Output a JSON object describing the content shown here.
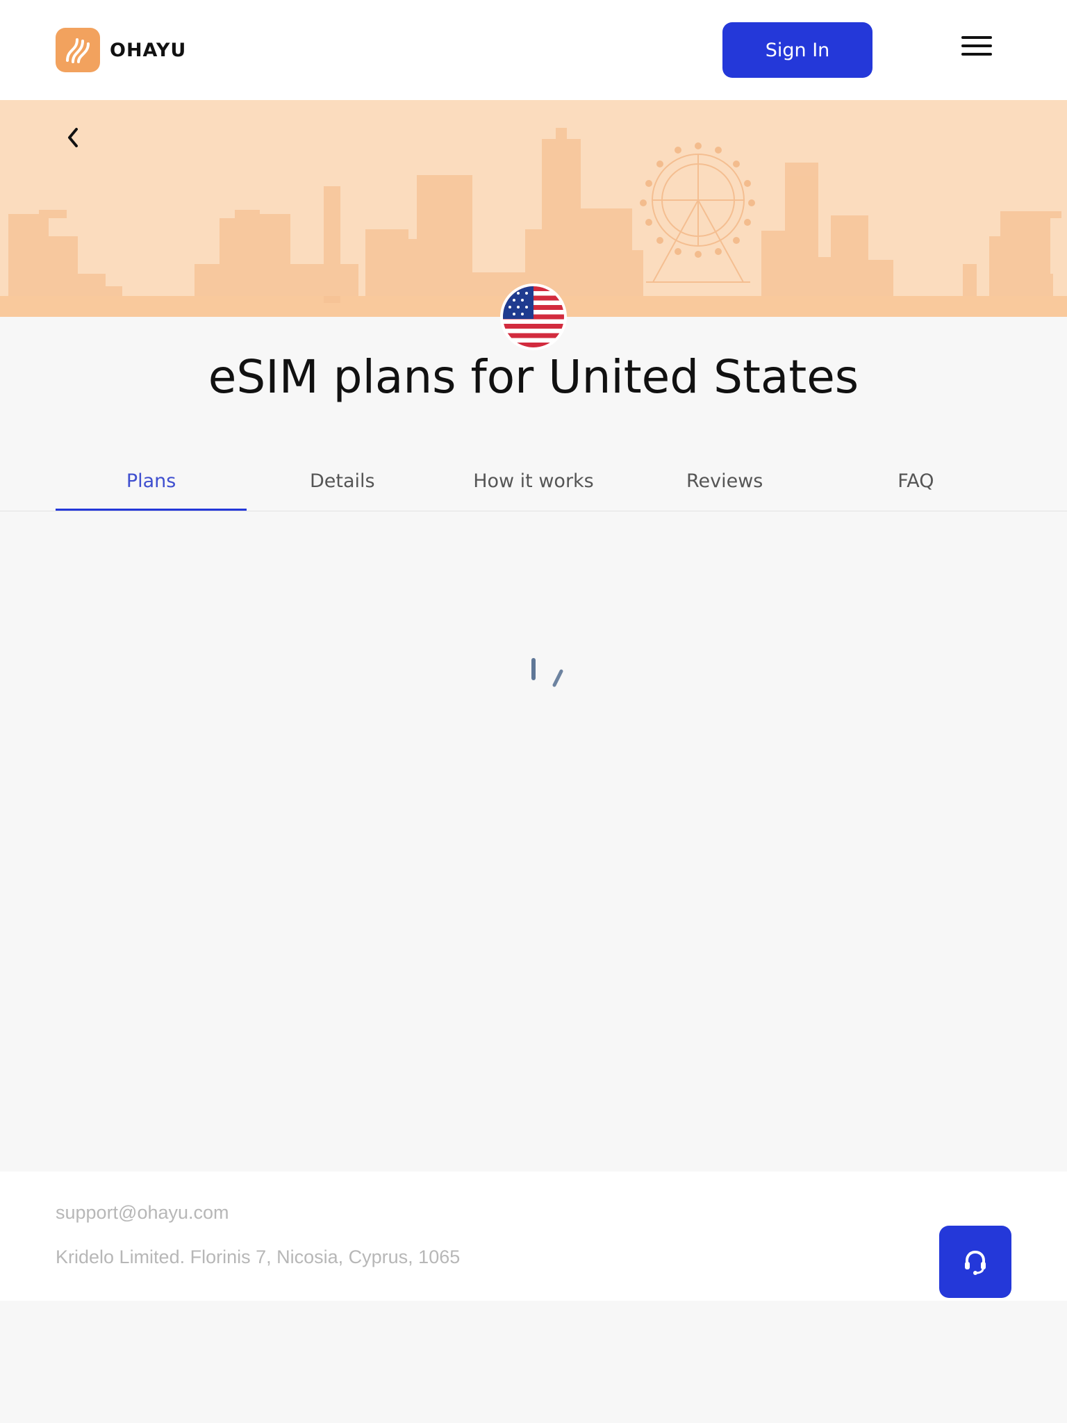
{
  "header": {
    "brand": "OHAYU",
    "sign_in_label": "Sign In"
  },
  "page": {
    "title": "eSIM plans for United States",
    "flag": "us-flag-icon"
  },
  "tabs": [
    {
      "label": "Plans",
      "active": true
    },
    {
      "label": "Details",
      "active": false
    },
    {
      "label": "How it works",
      "active": false
    },
    {
      "label": "Reviews",
      "active": false
    },
    {
      "label": "FAQ",
      "active": false
    }
  ],
  "content": {
    "state": "loading-spinner"
  },
  "footer": {
    "email": "support@ohayu.com",
    "address": "Kridelo Limited. Florinis 7, Nicosia, Cyprus, 1065"
  },
  "icons": {
    "logo": "ohayu-logo-icon",
    "menu": "hamburger-menu-icon",
    "back": "chevron-left-icon",
    "support": "headset-icon"
  },
  "colors": {
    "accent": "#2438d9",
    "brand_orange": "#f2a25e",
    "banner": "#fbdcbe",
    "active_tab_text": "#3f4fcf"
  }
}
